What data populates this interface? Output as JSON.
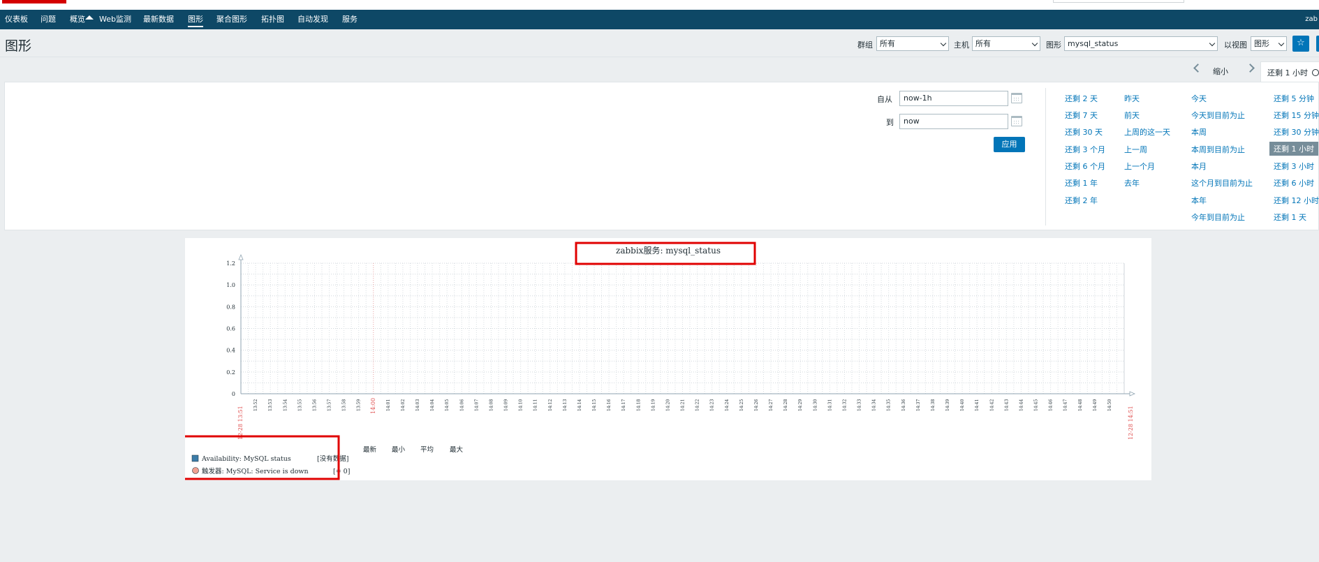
{
  "nav": {
    "items": [
      "仪表板",
      "问题",
      "概览",
      "Web监测",
      "最新数据",
      "图形",
      "聚合图形",
      "拓扑图",
      "自动发现",
      "服务"
    ],
    "active_index": 5,
    "right_text": "zab"
  },
  "header": {
    "title": "图形",
    "group_label": "群组",
    "group_value": "所有",
    "host_label": "主机",
    "host_value": "所有",
    "graph_label": "图形",
    "graph_value": "mysql_status",
    "view_label": "以视图",
    "view_value": "图形",
    "favourite_icon": "star-icon"
  },
  "time_nav": {
    "zoom_label": "缩小",
    "current_tab": "还剩 1 小时",
    "clock_icon": "clock-icon"
  },
  "filter": {
    "from_label": "自从",
    "from_value": "now-1h",
    "to_label": "到",
    "to_value": "now",
    "apply_label": "应用",
    "quick_ranges": [
      [
        "还剩 2 天",
        "还剩 7 天",
        "还剩 30 天",
        "还剩 3 个月",
        "还剩 6 个月",
        "还剩 1 年",
        "还剩 2 年"
      ],
      [
        "昨天",
        "前天",
        "上周的这一天",
        "上一周",
        "上一个月",
        "去年"
      ],
      [
        "今天",
        "今天到目前为止",
        "本周",
        "本周到目前为止",
        "本月",
        "这个月到目前为止",
        "本年",
        "今年到目前为止"
      ],
      [
        "还剩 5 分钟",
        "还剩 15 分钟",
        "还剩 30 分钟",
        "还剩 1 小时",
        "还剩 3 小时",
        "还剩 6 小时",
        "还剩 12 小时",
        "还剩 1 天"
      ]
    ],
    "selected_range": "还剩 1 小时"
  },
  "chart_data": {
    "type": "line",
    "title": "zabbix服务: mysql_status",
    "ylim": [
      0,
      1.2
    ],
    "y_ticks": [
      "0",
      "0.2",
      "0.4",
      "0.6",
      "0.8",
      "1.0",
      "1.2"
    ],
    "x_start_label": "12-28 13:51",
    "x_end_label": "12-28 14:51",
    "x_ticks": [
      "13:52",
      "13:53",
      "13:54",
      "13:55",
      "13:56",
      "13:57",
      "13:58",
      "13:59",
      "14:00",
      "14:01",
      "14:02",
      "14:03",
      "14:04",
      "14:05",
      "14:06",
      "14:07",
      "14:08",
      "14:09",
      "14:10",
      "14:11",
      "14:12",
      "14:13",
      "14:14",
      "14:15",
      "14:16",
      "14:17",
      "14:18",
      "14:19",
      "14:20",
      "14:21",
      "14:22",
      "14:23",
      "14:24",
      "14:25",
      "14:26",
      "14:27",
      "14:28",
      "14:29",
      "14:30",
      "14:31",
      "14:32",
      "14:33",
      "14:34",
      "14:35",
      "14:36",
      "14:37",
      "14:38",
      "14:39",
      "14:40",
      "14:41",
      "14:42",
      "14:43",
      "14:44",
      "14:45",
      "14:46",
      "14:47",
      "14:48",
      "14:49",
      "14:50"
    ],
    "legend_headers": [
      "最新",
      "最小",
      "平均",
      "最大"
    ],
    "series": [
      {
        "name": "Availability: MySQL status",
        "status": "[没有数据]",
        "color": "#3c7ca8",
        "values": []
      }
    ],
    "triggers": [
      {
        "name": "触发器: MySQL: Service is down",
        "condition": "[= 0]",
        "color": "#f0a090"
      }
    ],
    "grid": true
  },
  "colors": {
    "nav_bg": "#0e4866",
    "accent": "#0275b8",
    "highlight": "#e00000"
  }
}
